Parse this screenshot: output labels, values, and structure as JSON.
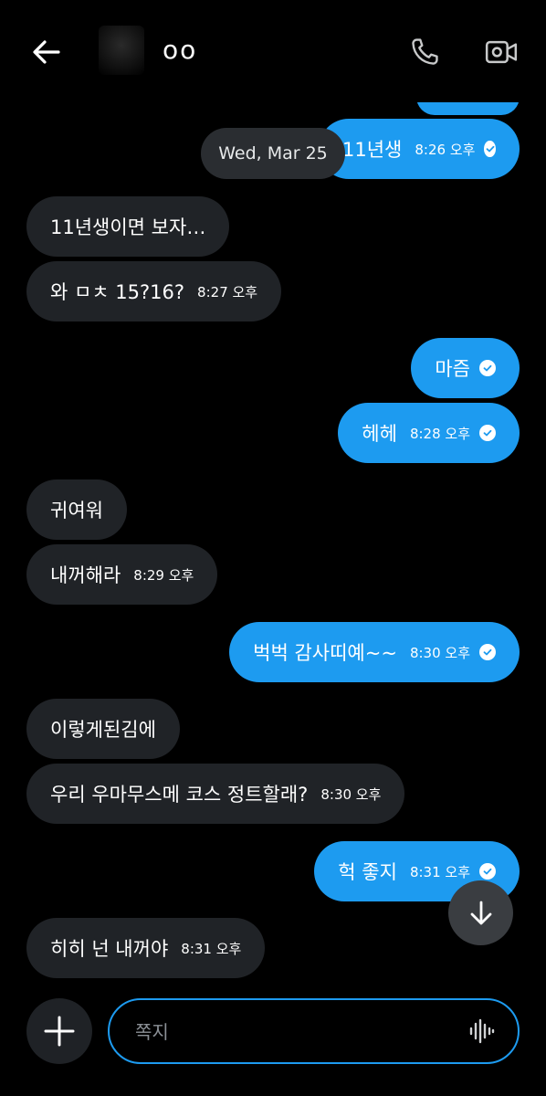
{
  "header": {
    "username": "oo"
  },
  "date_separator": "Wed, Mar 25",
  "messages": [
    {
      "dir": "out",
      "text": "11년생",
      "time": "8:26 오후",
      "read": true
    },
    {
      "dir": "in",
      "text": "11년생이면 보자…",
      "time": "",
      "read": false
    },
    {
      "dir": "in",
      "text": "와 ㅁㅊ 15?16?",
      "time": "8:27 오후",
      "read": false
    },
    {
      "dir": "out",
      "text": "마즘",
      "time": "",
      "read": true
    },
    {
      "dir": "out",
      "text": "헤헤",
      "time": "8:28 오후",
      "read": true
    },
    {
      "dir": "in",
      "text": "귀여워",
      "time": "",
      "read": false
    },
    {
      "dir": "in",
      "text": "내꺼해라",
      "time": "8:29 오후",
      "read": false
    },
    {
      "dir": "out",
      "text": "벅벅 감사띠예~~",
      "time": "8:30 오후",
      "read": true
    },
    {
      "dir": "in",
      "text": "이렇게된김에",
      "time": "",
      "read": false
    },
    {
      "dir": "in",
      "text": "우리 우마무스메 코스 정트할래?",
      "time": "8:30 오후",
      "read": false
    },
    {
      "dir": "out",
      "text": "헉 좋지",
      "time": "8:31 오후",
      "read": true
    },
    {
      "dir": "in",
      "text": "히히 넌 내꺼야",
      "time": "8:31 오후",
      "read": false
    }
  ],
  "composer": {
    "placeholder": "쪽지"
  },
  "colors": {
    "outgoing_bubble": "#1d9bf0",
    "incoming_bubble": "#202327",
    "background": "#000000"
  },
  "icons": {
    "back": "arrow-left-icon",
    "call": "phone-icon",
    "video": "video-camera-icon",
    "read": "check-circle-icon",
    "scroll": "arrow-down-icon",
    "add": "plus-icon",
    "voice": "waveform-icon"
  }
}
